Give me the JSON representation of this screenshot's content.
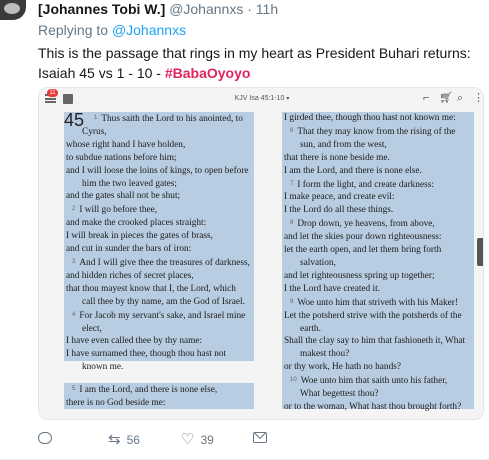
{
  "tweet": {
    "name": "[Johannes Tobi W.]",
    "handle": "@Johannxs",
    "separator": "·",
    "time": "11h",
    "replying_prefix": "Replying to",
    "replying_handle": "@Johannxs",
    "text": "This is the passage that rings in my heart as President Buhari returns: Isaiah 45 vs 1 - 10 - ",
    "hashtag": "#BabaOyoyo"
  },
  "bible_app": {
    "notification_count": "11",
    "reference": "KJV Isa 45:1-10",
    "chapter": "45",
    "left_column": [
      {
        "v": "1",
        "t": "Thus saith the Lord to his anointed, to",
        "cls": "first"
      },
      {
        "v": "",
        "t": "Cyrus,",
        "cls": "ind"
      },
      {
        "v": "",
        "t": "whose right hand I have holden,",
        "cls": ""
      },
      {
        "v": "",
        "t": "to subdue nations before him;",
        "cls": ""
      },
      {
        "v": "",
        "t": "and I will loose the loins of kings, to open before",
        "cls": ""
      },
      {
        "v": "",
        "t": "him the two leaved gates;",
        "cls": "ind"
      },
      {
        "v": "",
        "t": "and the gates shall not be shut;",
        "cls": ""
      },
      {
        "v": "2",
        "t": "I will go before thee,",
        "cls": "vline"
      },
      {
        "v": "",
        "t": "and make the crooked places straight:",
        "cls": ""
      },
      {
        "v": "",
        "t": "I will break in pieces the gates of brass,",
        "cls": ""
      },
      {
        "v": "",
        "t": "and cut in sunder the bars of iron:",
        "cls": ""
      },
      {
        "v": "3",
        "t": "And I will give thee the treasures of darkness,",
        "cls": "vline"
      },
      {
        "v": "",
        "t": "and hidden riches of secret places,",
        "cls": ""
      },
      {
        "v": "",
        "t": "that thou mayest know that I, the Lord, which",
        "cls": ""
      },
      {
        "v": "",
        "t": "call thee by thy name, am the God of Israel.",
        "cls": "ind"
      },
      {
        "v": "4",
        "t": "For Jacob my servant's sake, and Israel mine",
        "cls": "vline"
      },
      {
        "v": "",
        "t": "elect,",
        "cls": "ind"
      },
      {
        "v": "",
        "t": "I have even called thee by thy name:",
        "cls": ""
      },
      {
        "v": "",
        "t": "I have surnamed thee, though thou hast not",
        "cls": ""
      },
      {
        "v": "",
        "t": "known me.",
        "cls": "ind"
      }
    ],
    "left_column_2": [
      {
        "v": "5",
        "t": "I am the Lord, and there is none else,",
        "cls": "vline"
      },
      {
        "v": "",
        "t": "there is no God beside me:",
        "cls": ""
      }
    ],
    "right_column": [
      {
        "v": "",
        "t": "I girded thee, though thou hast not known me:",
        "cls": ""
      },
      {
        "v": "6",
        "t": "That they may know from the rising of the",
        "cls": "vline"
      },
      {
        "v": "",
        "t": "sun, and from the west,",
        "cls": "ind"
      },
      {
        "v": "",
        "t": "that there is none beside me.",
        "cls": ""
      },
      {
        "v": "",
        "t": "I am the Lord, and there is none else.",
        "cls": ""
      },
      {
        "v": "7",
        "t": "I form the light, and create darkness:",
        "cls": "vline"
      },
      {
        "v": "",
        "t": "I make peace, and create evil:",
        "cls": ""
      },
      {
        "v": "",
        "t": "I the Lord do all these things.",
        "cls": ""
      },
      {
        "v": "8",
        "t": "Drop down, ye heavens, from above,",
        "cls": "vline"
      },
      {
        "v": "",
        "t": "and let the skies pour down righteousness:",
        "cls": ""
      },
      {
        "v": "",
        "t": "let the earth open, and let them bring forth",
        "cls": ""
      },
      {
        "v": "",
        "t": "salvation,",
        "cls": "ind"
      },
      {
        "v": "",
        "t": "and let righteousness spring up together;",
        "cls": ""
      },
      {
        "v": "",
        "t": "I the Lord have created it.",
        "cls": ""
      },
      {
        "v": "9",
        "t": "Woe unto him that striveth with his Maker!",
        "cls": "vline"
      },
      {
        "v": "",
        "t": "Let the potsherd strive with the potsherds of the",
        "cls": ""
      },
      {
        "v": "",
        "t": "earth.",
        "cls": "ind"
      },
      {
        "v": "",
        "t": "Shall the clay say to him that fashioneth it, What",
        "cls": ""
      },
      {
        "v": "",
        "t": "makest thou?",
        "cls": "ind"
      },
      {
        "v": "",
        "t": "or thy work, He hath no hands?",
        "cls": ""
      },
      {
        "v": "10",
        "t": "Woe unto him that saith unto his father,",
        "cls": "vline"
      },
      {
        "v": "",
        "t": "What begettest thou?",
        "cls": "ind"
      },
      {
        "v": "",
        "t": "or to the woman, What hast thou brought forth?",
        "cls": ""
      }
    ]
  },
  "actions": {
    "reply_count": "",
    "retweet_count": "56",
    "like_count": "39"
  },
  "colors": {
    "highlight": "#b9cde2",
    "hashtag": "#e0245e",
    "link": "#1da1f2"
  }
}
